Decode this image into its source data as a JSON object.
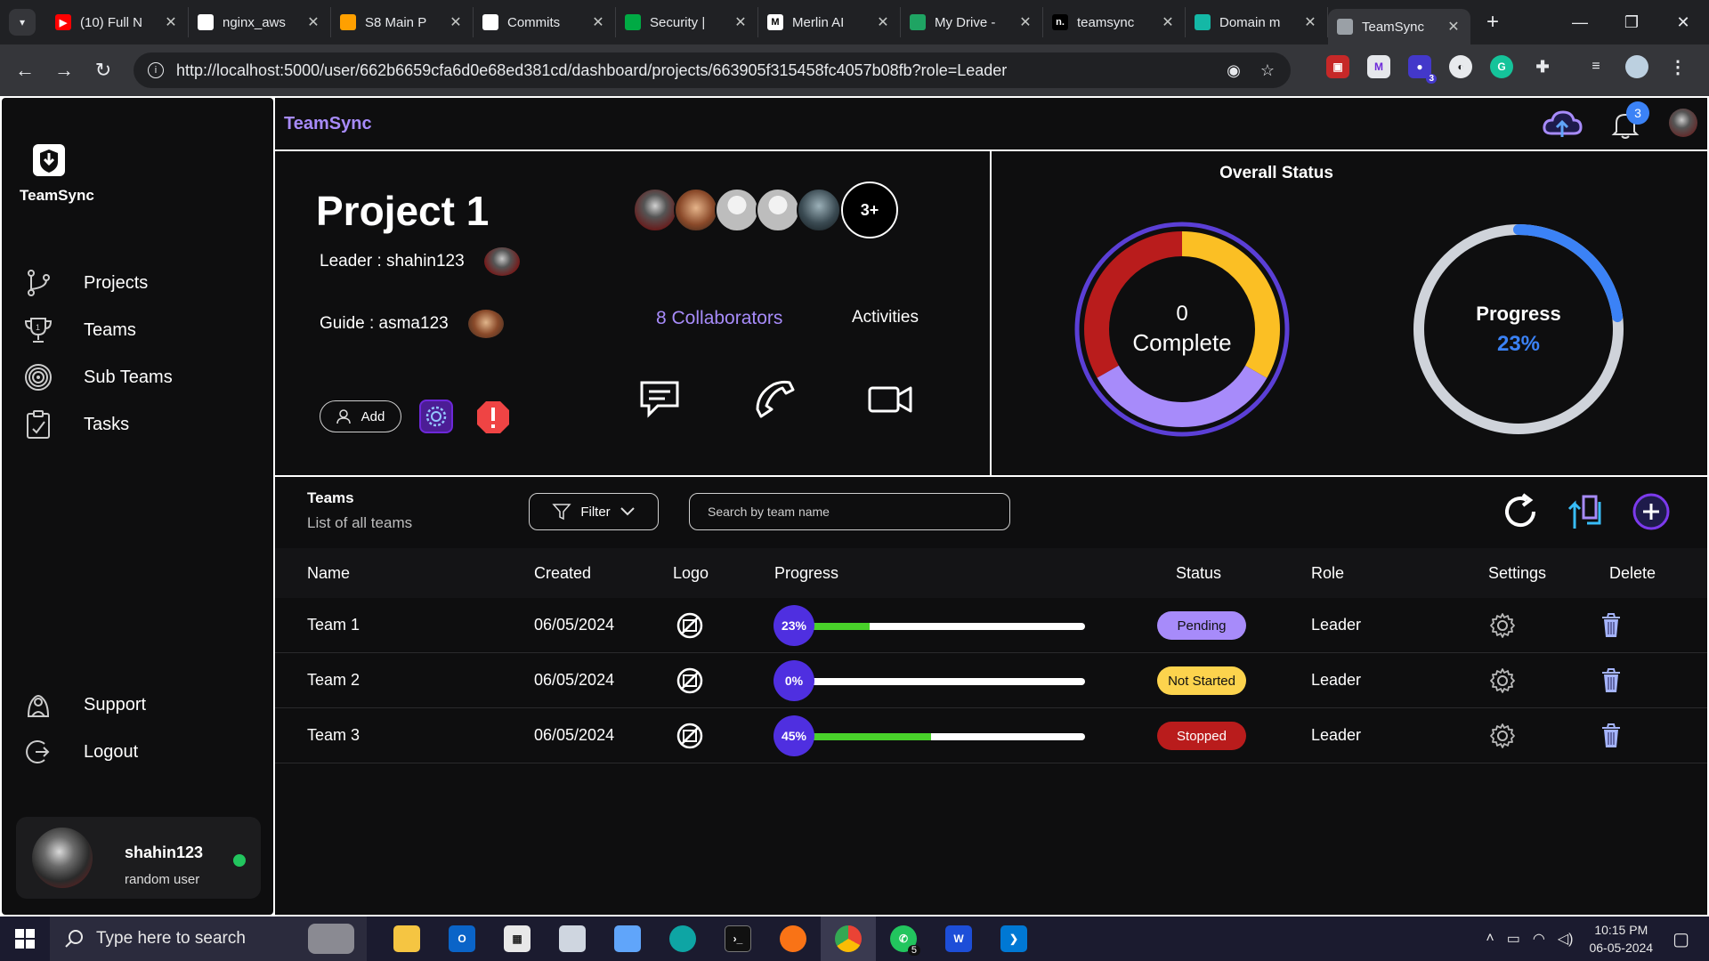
{
  "browser": {
    "tabs": [
      {
        "label": "(10) Full N",
        "fav_color": "#ff0000",
        "fav_text": "▶"
      },
      {
        "label": "nginx_aws",
        "fav_color": "#ffffff",
        "fav_text": ""
      },
      {
        "label": "S8 Main P",
        "fav_color": "#ffa000",
        "fav_text": ""
      },
      {
        "label": "Commits",
        "fav_color": "#ffffff",
        "fav_text": ""
      },
      {
        "label": "Security |",
        "fav_color": "#00aa44",
        "fav_text": ""
      },
      {
        "label": "Merlin AI",
        "fav_color": "#ffffff",
        "fav_text": "M"
      },
      {
        "label": "My Drive -",
        "fav_color": "#1fa463",
        "fav_text": ""
      },
      {
        "label": "teamsync",
        "fav_color": "#000000",
        "fav_text": "n."
      },
      {
        "label": "Domain m",
        "fav_color": "#14b8a6",
        "fav_text": ""
      },
      {
        "label": "TeamSync",
        "fav_color": "#9aa0a6",
        "fav_text": ""
      }
    ],
    "url": "http://localhost:5000/user/662b6659cfa6d0e68ed381cd/dashboard/projects/663905f315458fc4057b08fb?role=Leader",
    "extension_badge": "3"
  },
  "sidebar": {
    "brand": "TeamSync",
    "nav": [
      {
        "label": "Projects",
        "icon": "branch-icon"
      },
      {
        "label": "Teams",
        "icon": "trophy-icon"
      },
      {
        "label": "Sub Teams",
        "icon": "target-icon"
      },
      {
        "label": "Tasks",
        "icon": "clipboard-icon"
      }
    ],
    "support": "Support",
    "logout": "Logout",
    "profile": {
      "name": "shahin123",
      "role": "random user"
    }
  },
  "topbar": {
    "title": "TeamSync",
    "notification_count": "3"
  },
  "project": {
    "title": "Project 1",
    "leader_label": "Leader : shahin123",
    "guide_label": "Guide : asma123",
    "add_label": "Add",
    "collaborators_more": "3+",
    "collaborators_label": "8 Collaborators",
    "activities_label": "Activities"
  },
  "overall_status": {
    "title": "Overall Status",
    "complete_count": "0",
    "complete_label": "Complete",
    "progress_label": "Progress",
    "progress_value": "23%",
    "progress_fraction": 0.23,
    "segments": [
      {
        "name": "pending",
        "fraction": 0.333,
        "color": "#fbbf24"
      },
      {
        "name": "not-started",
        "fraction": 0.334,
        "color": "#a78bfa"
      },
      {
        "name": "stopped",
        "fraction": 0.333,
        "color": "#b91c1c"
      }
    ]
  },
  "teams": {
    "title": "Teams",
    "subtitle": "List of all teams",
    "filter_label": "Filter",
    "search_placeholder": "Search by team name",
    "columns": [
      "Name",
      "Created",
      "Logo",
      "Progress",
      "Status",
      "Role",
      "Settings",
      "Delete"
    ],
    "rows": [
      {
        "name": "Team 1",
        "created": "06/05/2024",
        "progress": "23%",
        "progress_fraction": 0.23,
        "status": "Pending",
        "status_bg": "#a78bfa",
        "status_fg": "#111111",
        "role": "Leader"
      },
      {
        "name": "Team 2",
        "created": "06/05/2024",
        "progress": "0%",
        "progress_fraction": 0,
        "status": "Not Started",
        "status_bg": "#fcd34d",
        "status_fg": "#111111",
        "role": "Leader"
      },
      {
        "name": "Team 3",
        "created": "06/05/2024",
        "progress": "45%",
        "progress_fraction": 0.45,
        "status": "Stopped",
        "status_bg": "#b91c1c",
        "status_fg": "#ffffff",
        "role": "Leader"
      }
    ]
  },
  "taskbar": {
    "search_placeholder": "Type here to search",
    "time": "10:15 PM",
    "date": "06-05-2024",
    "whatsapp_badge": "5"
  }
}
